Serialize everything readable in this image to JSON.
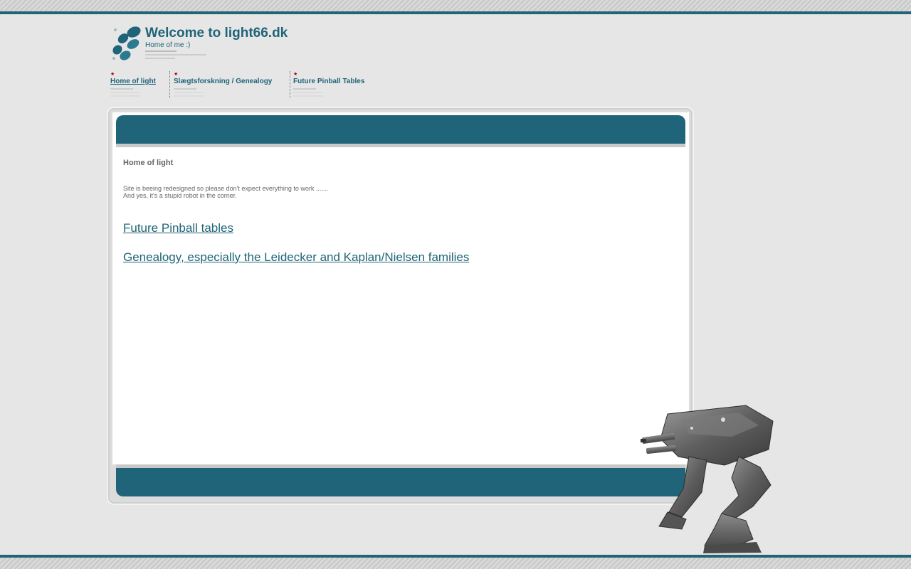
{
  "header": {
    "title": "Welcome to light66.dk",
    "subtitle": "Home of me :)"
  },
  "nav": {
    "items": [
      {
        "label": "Home of light"
      },
      {
        "label": "Slægtsforskning / Genealogy"
      },
      {
        "label": "Future Pinball Tables"
      }
    ]
  },
  "content": {
    "heading": "Home of light",
    "notice_line1": "Site is beeing redesigned so please don't expect everything to work .......",
    "notice_line2": "And yes, it's a stupid robot in the corner.",
    "links": [
      {
        "label": "Future Pinball tables"
      },
      {
        "label": "Genealogy, especially the Leidecker and Kaplan/Nielsen families"
      }
    ]
  },
  "colors": {
    "accent": "#1f6478",
    "background": "#e6e6e6",
    "nav_star": "#b00000"
  },
  "icons": {
    "logo": "paw-print-icon",
    "nav_marker": "star-icon",
    "mascot": "robot-mech-image"
  }
}
